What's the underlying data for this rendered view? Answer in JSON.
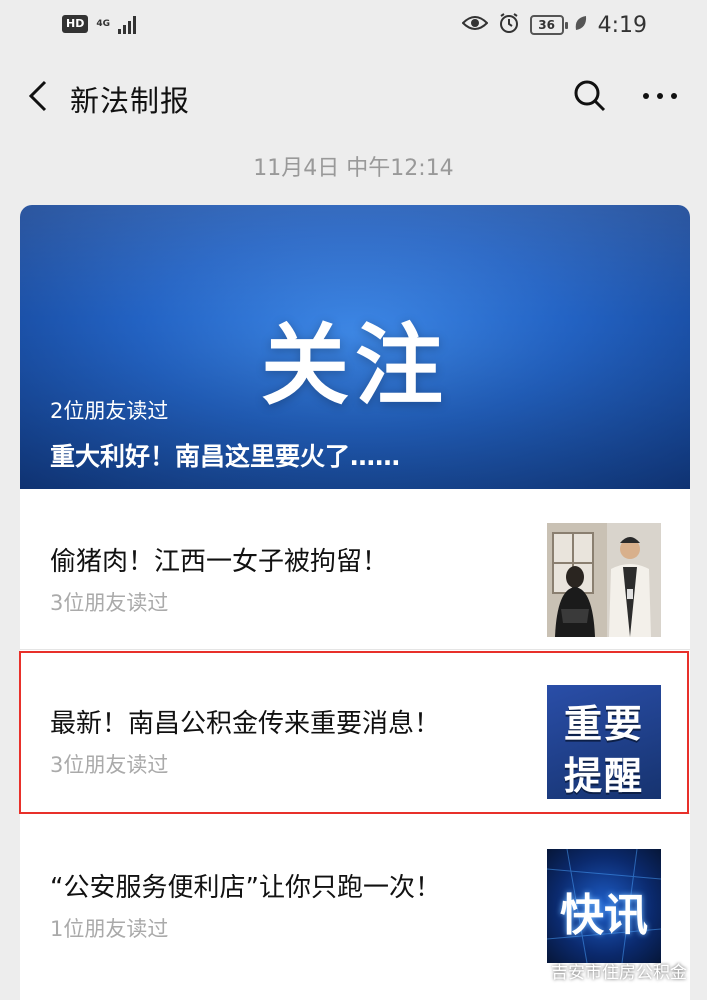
{
  "status_bar": {
    "hd": "HD",
    "network": "4G",
    "battery": "36",
    "time": "4:19"
  },
  "nav": {
    "title": "新法制报",
    "icons": [
      "back-arrow-icon",
      "search-icon",
      "more-icon"
    ]
  },
  "timestamp": "11月4日 中午12:14",
  "hero": {
    "image_text": "关注",
    "readers": "2位朋友读过",
    "title": "重大利好！南昌这里要火了……"
  },
  "articles": [
    {
      "title": "偷猪肉！江西一女子被拘留！",
      "readers": "3位朋友读过",
      "thumb": "photo"
    },
    {
      "title": "最新！南昌公积金传来重要消息！",
      "readers": "3位朋友读过",
      "thumb_lines": [
        "重要",
        "提醒"
      ]
    },
    {
      "title": "“公安服务便利店”让你只跑一次！",
      "readers": "1位朋友读过",
      "thumb_text": "快讯"
    }
  ],
  "watermark": "吉安市住房公积金",
  "colors": {
    "background": "#ededed",
    "highlight": "#e8302a",
    "hero_blue": "#2363c4"
  }
}
